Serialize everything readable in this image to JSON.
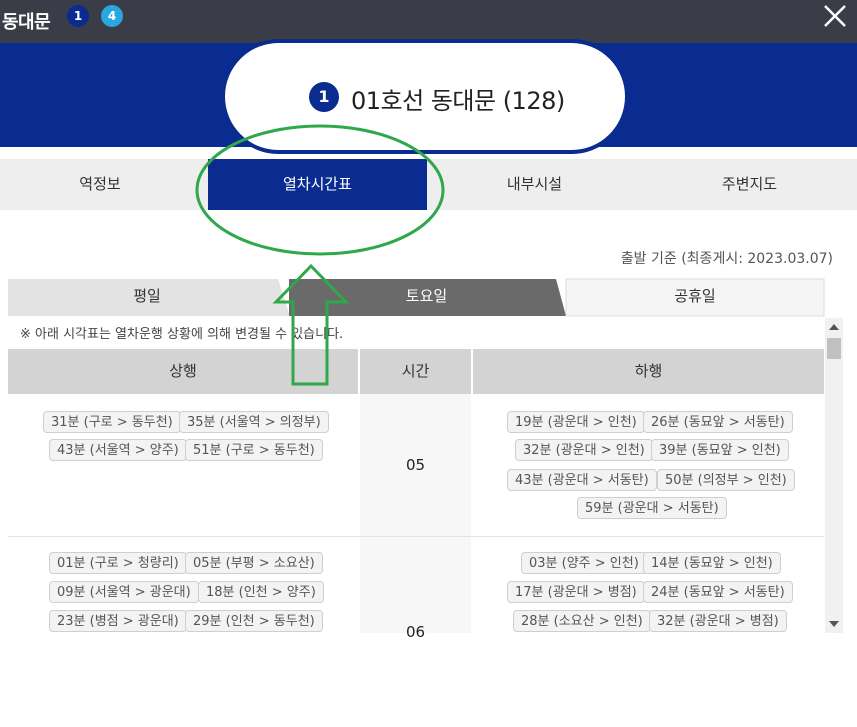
{
  "window": {
    "title": "동대문",
    "line_badges": [
      {
        "label": "1",
        "color": "#0a2b8f"
      },
      {
        "label": "4",
        "color": "#2aa7e0"
      }
    ]
  },
  "station": {
    "line_number": "1",
    "name": "01호선 동대문 (128)"
  },
  "tabs": [
    "역정보",
    "열차시간표",
    "내부시설",
    "주변지도"
  ],
  "active_tab": "열차시간표",
  "timetable": {
    "basis": "출발 기준 (최종게시: 2023.03.07)",
    "day_tabs": [
      "평일",
      "토요일",
      "공휴일"
    ],
    "active_day": "토요일",
    "note": "※ 아래 시각표는 열차운행 상황에 의해 변경될 수 있습니다.",
    "headers": {
      "up": "상행",
      "time": "시간",
      "down": "하행"
    },
    "rows": [
      {
        "hour": "05",
        "up": [
          "31분 (구로 > 동두천)",
          "35분 (서울역 > 의정부)",
          "43분 (서울역 > 양주)",
          "51분 (구로 > 동두천)"
        ],
        "down": [
          "19분 (광운대 > 인천)",
          "26분 (동묘앞 > 서동탄)",
          "32분 (광운대 > 인천)",
          "39분 (동묘앞 > 인천)",
          "43분 (광운대 > 서동탄)",
          "50분 (의정부 > 인천)",
          "59분 (광운대 > 서동탄)"
        ]
      },
      {
        "hour": "06",
        "up": [
          "01분 (구로 > 청량리)",
          "05분 (부평 > 소요산)",
          "09분 (서울역 > 광운대)",
          "18분 (인천 > 양주)",
          "23분 (병점 > 광운대)",
          "29분 (인천 > 동두천)"
        ],
        "down": [
          "03분 (양주 > 인천)",
          "14분 (동묘앞 > 인천)",
          "17분 (광운대 > 병점)",
          "24분 (동묘앞 > 서동탄)",
          "28분 (소요산 > 인천)",
          "32분 (광운대 > 병점)"
        ]
      }
    ]
  },
  "colors": {
    "primary": "#0a2b8f",
    "annotation": "#2ea84a",
    "topbar": "#3a3d47"
  },
  "icons": {
    "close": "close-icon"
  }
}
